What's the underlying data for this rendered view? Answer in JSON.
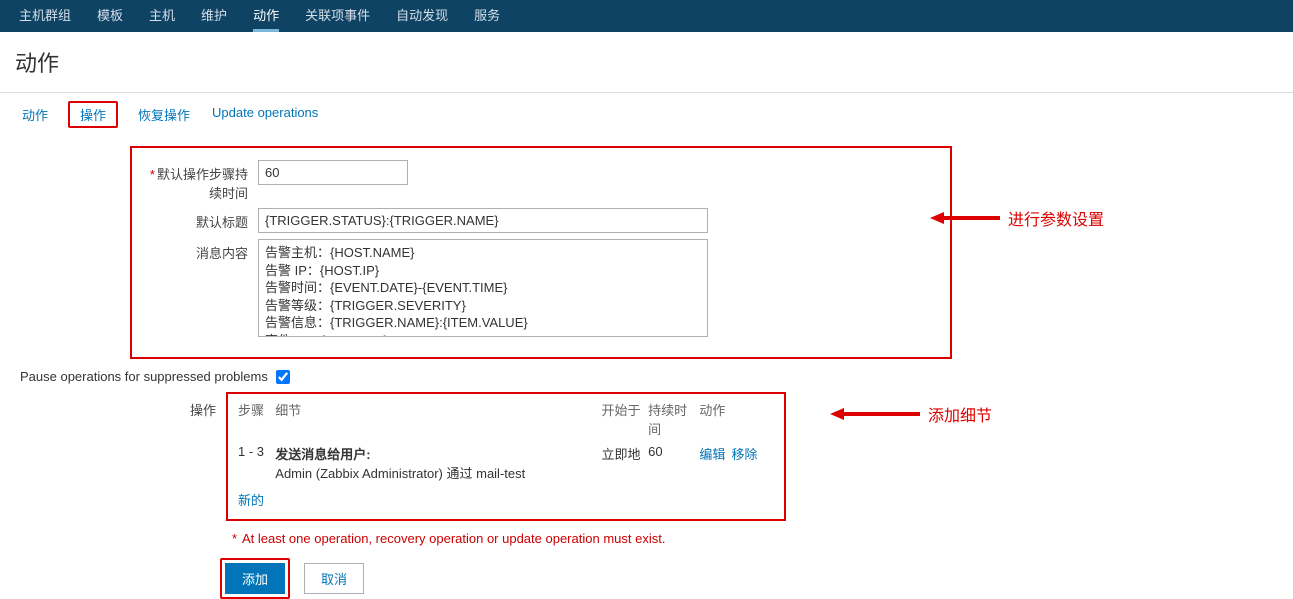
{
  "topnav": {
    "items": [
      "主机群组",
      "模板",
      "主机",
      "维护",
      "动作",
      "关联项事件",
      "自动发现",
      "服务"
    ],
    "active_index": 4
  },
  "page_title": "动作",
  "sub_tabs": {
    "items": [
      "动作",
      "操作",
      "恢复操作",
      "Update operations"
    ],
    "active_index": 1
  },
  "form": {
    "default_step_duration_label": "默认操作步骤持续时间",
    "default_step_duration_value": "60",
    "default_subject_label": "默认标题",
    "default_subject_value": "{TRIGGER.STATUS}:{TRIGGER.NAME}",
    "message_content_label": "消息内容",
    "message_content_value": "告警主机：{HOST.NAME}\n告警 IP：{HOST.IP}\n告警时间：{EVENT.DATE}-{EVENT.TIME}\n告警等级：{TRIGGER.SEVERITY}\n告警信息：{TRIGGER.NAME}:{ITEM.VALUE}\n事件 ID：{EVENT.ID}"
  },
  "pause_label": "Pause operations for suppressed problems",
  "pause_checked": true,
  "operations": {
    "label": "操作",
    "header": {
      "steps": "步骤",
      "detail": "细节",
      "start": "开始于",
      "duration": "持续时间",
      "action": "动作"
    },
    "rows": [
      {
        "steps": "1 - 3",
        "detail_prefix": "发送消息给用户:",
        "detail_rest": " Admin (Zabbix Administrator) 通过 mail-test",
        "start": "立即地",
        "duration": "60",
        "edit": "编辑",
        "remove": "移除"
      }
    ],
    "new_label": "新的"
  },
  "note_text": "At least one operation, recovery operation or update operation must exist.",
  "buttons": {
    "add": "添加",
    "cancel": "取消"
  },
  "annotations": {
    "params": "进行参数设置",
    "details": "添加细节"
  }
}
